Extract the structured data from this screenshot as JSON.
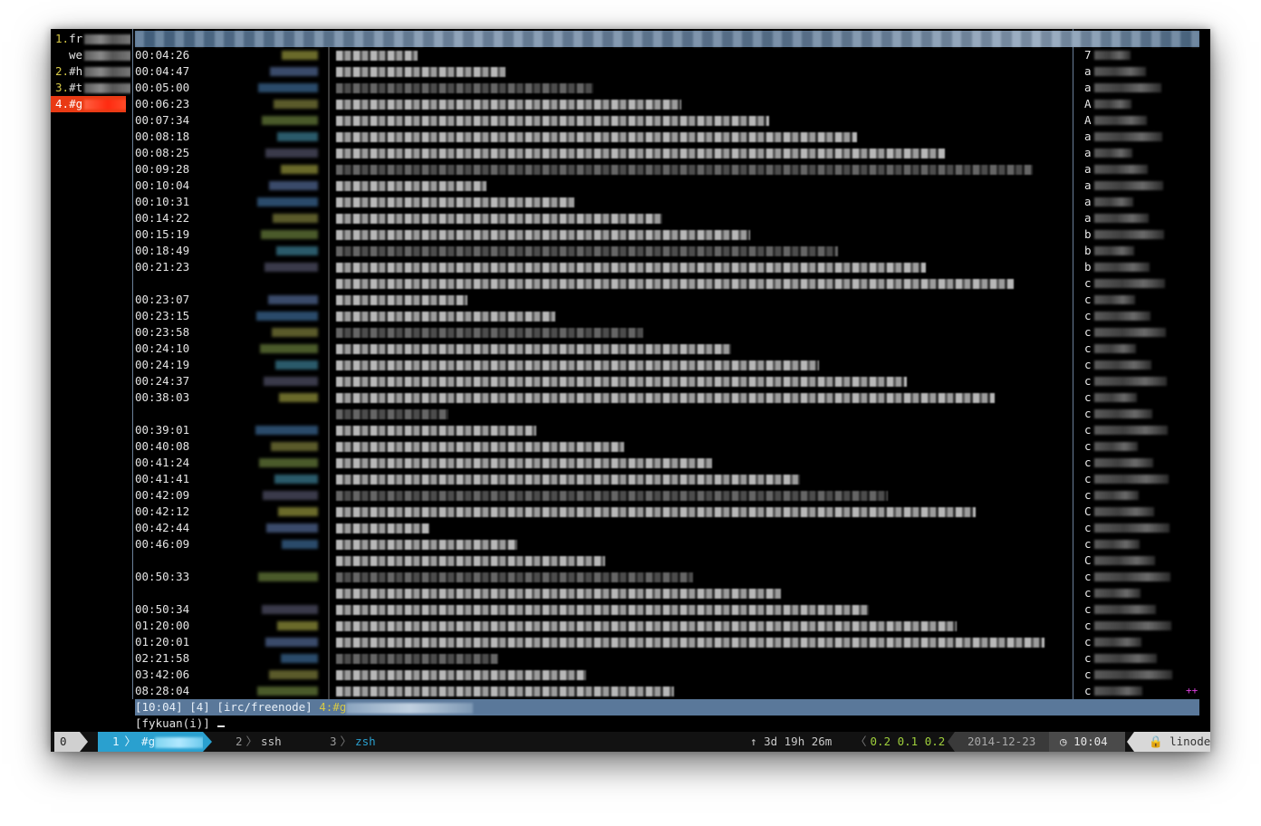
{
  "buffers": [
    {
      "num": "1.",
      "name": "fr"
    },
    {
      "num": "",
      "name": "we"
    },
    {
      "num": "2.",
      "name": "#h"
    },
    {
      "num": "3.",
      "name": "#t"
    },
    {
      "num": "4.",
      "name": "#g"
    }
  ],
  "timestamps": [
    "00:04:26",
    "00:04:47",
    "00:05:00",
    "00:06:23",
    "00:07:34",
    "00:08:18",
    "00:08:25",
    "00:09:28",
    "00:10:04",
    "00:10:31",
    "00:14:22",
    "00:15:19",
    "00:18:49",
    "00:21:23",
    "",
    "00:23:07",
    "00:23:15",
    "00:23:58",
    "00:24:10",
    "00:24:19",
    "00:24:37",
    "00:38:03",
    "",
    "00:39:01",
    "00:40:08",
    "00:41:24",
    "00:41:41",
    "00:42:09",
    "00:42:12",
    "00:42:44",
    "00:46:09",
    "",
    "00:50:33",
    "",
    "00:50:34",
    "01:20:00",
    "01:20:01",
    "02:21:58",
    "03:42:06",
    "08:28:04"
  ],
  "nicklist": [
    "7",
    "a",
    "a",
    "A",
    "A",
    "a",
    "a",
    "a",
    "a",
    "a",
    "a",
    "b",
    "b",
    "b",
    "c",
    "c",
    "c",
    "c",
    "c",
    "c",
    "c",
    "c",
    "c",
    "c",
    "c",
    "c",
    "c",
    "c",
    "C",
    "c",
    "c",
    "C",
    "c",
    "c",
    "c",
    "c",
    "c",
    "c",
    "c",
    "c"
  ],
  "nicklist_more": "++",
  "status_bar": {
    "time": "[10:04]",
    "window": "[4]",
    "server": "[irc/freenode]",
    "activity": "4:#g"
  },
  "input": {
    "prompt": "[fykuan(i)]"
  },
  "tmux": {
    "session": "0",
    "current_window_index": "1",
    "current_window_name": "#g",
    "windows": [
      {
        "index": "2",
        "name": "ssh"
      },
      {
        "index": "3",
        "name": "zsh"
      }
    ],
    "uptime": "3d 19h 26m",
    "load": "0.2 0.1 0.2",
    "date": "2014-12-23",
    "time": "10:04",
    "host": "linode"
  }
}
